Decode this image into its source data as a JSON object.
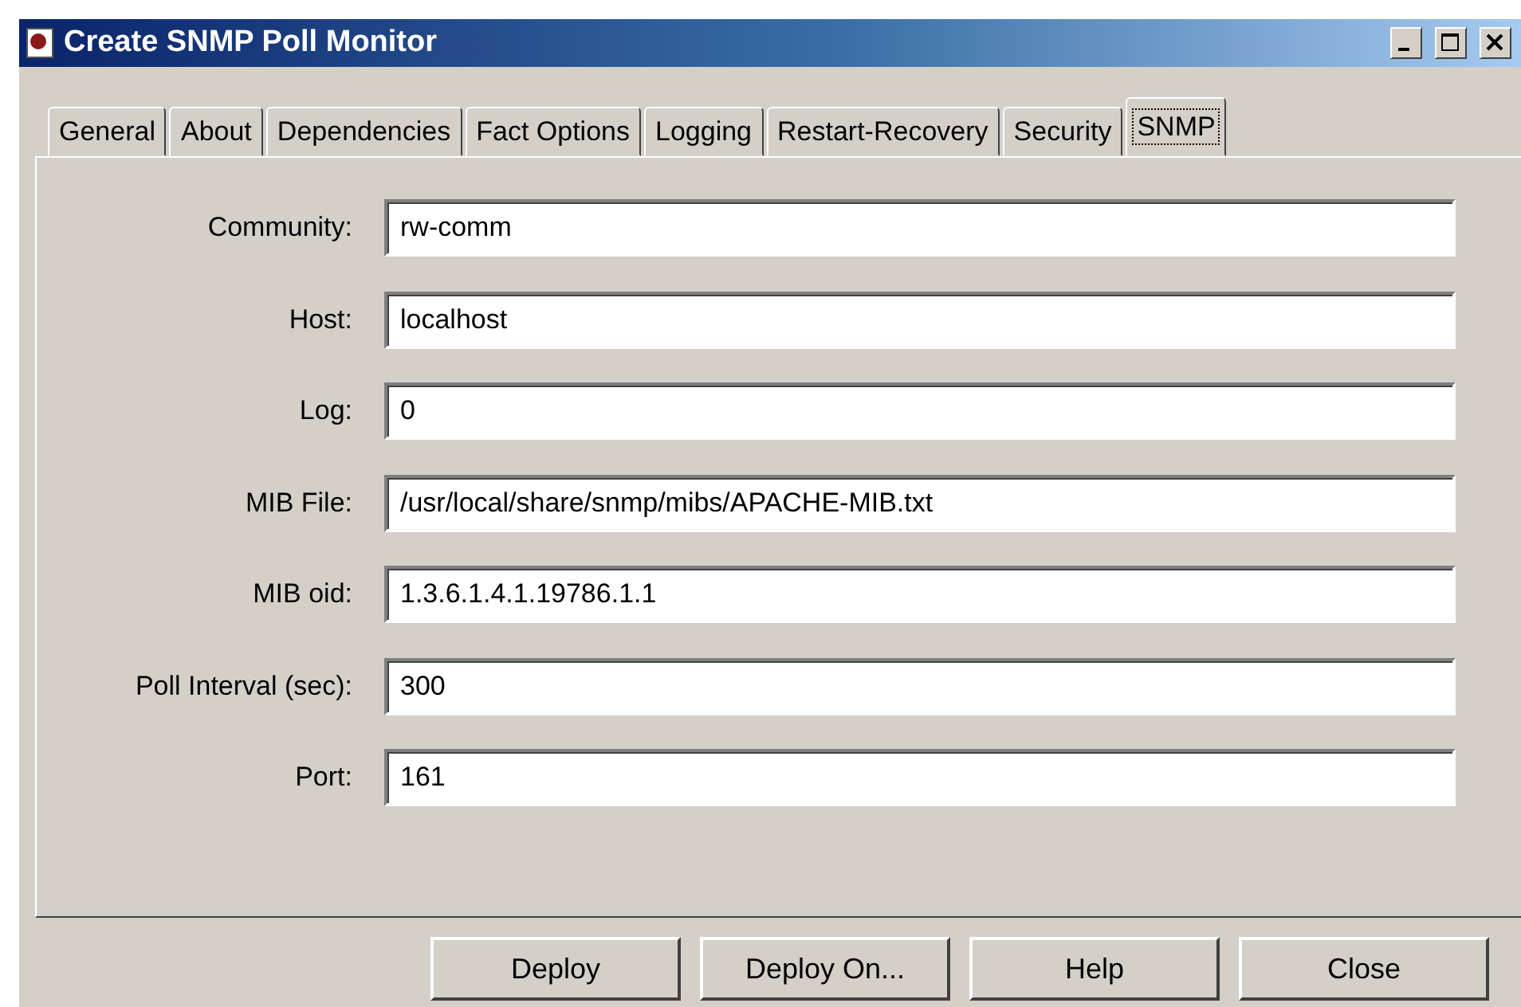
{
  "window": {
    "title": "Create SNMP Poll Monitor"
  },
  "tabs": [
    {
      "label": "General",
      "selected": false
    },
    {
      "label": "About",
      "selected": false
    },
    {
      "label": "Dependencies",
      "selected": false
    },
    {
      "label": "Fact Options",
      "selected": false
    },
    {
      "label": "Logging",
      "selected": false
    },
    {
      "label": "Restart-Recovery",
      "selected": false
    },
    {
      "label": "Security",
      "selected": false
    },
    {
      "label": "SNMP",
      "selected": true
    }
  ],
  "fields": [
    {
      "label": "Community:",
      "value": "rw-comm"
    },
    {
      "label": "Host:",
      "value": "localhost"
    },
    {
      "label": "Log:",
      "value": "0"
    },
    {
      "label": "MIB File:",
      "value": "/usr/local/share/snmp/mibs/APACHE-MIB.txt"
    },
    {
      "label": "MIB oid:",
      "value": "1.3.6.1.4.1.19786.1.1"
    },
    {
      "label": "Poll Interval (sec):",
      "value": "300"
    },
    {
      "label": "Port:",
      "value": "161"
    }
  ],
  "buttons": [
    "Deploy",
    "Deploy On...",
    "Help",
    "Close"
  ]
}
